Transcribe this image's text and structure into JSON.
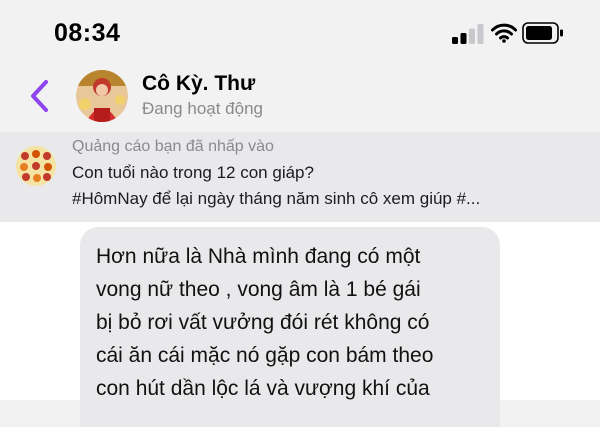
{
  "status_bar": {
    "time": "08:34",
    "icons": [
      "cellular-signal-icon",
      "wifi-icon",
      "battery-icon"
    ]
  },
  "header": {
    "back_icon": "chevron-left-icon",
    "contact_name": "Cô Kỳ. Thư",
    "contact_status": "Đang hoạt động",
    "accent_color": "#8e44ef"
  },
  "ad_reference": {
    "label": "Quảng cáo bạn đã nhấp vào",
    "lines": [
      "Con tuổi nào trong 12 con giáp?",
      "#HômNay để lại ngày tháng năm sinh cô xem giúp #..."
    ]
  },
  "message": {
    "lines": [
      "Hơn nữa là Nhà mình đang có một",
      "vong nữ theo , vong âm là 1 bé gái",
      "bị bỏ rơi vất vưởng đói rét không có",
      "cái ăn cái mặc nó gặp con bám theo",
      "con hút dần lộc lá và vượng khí của"
    ]
  }
}
